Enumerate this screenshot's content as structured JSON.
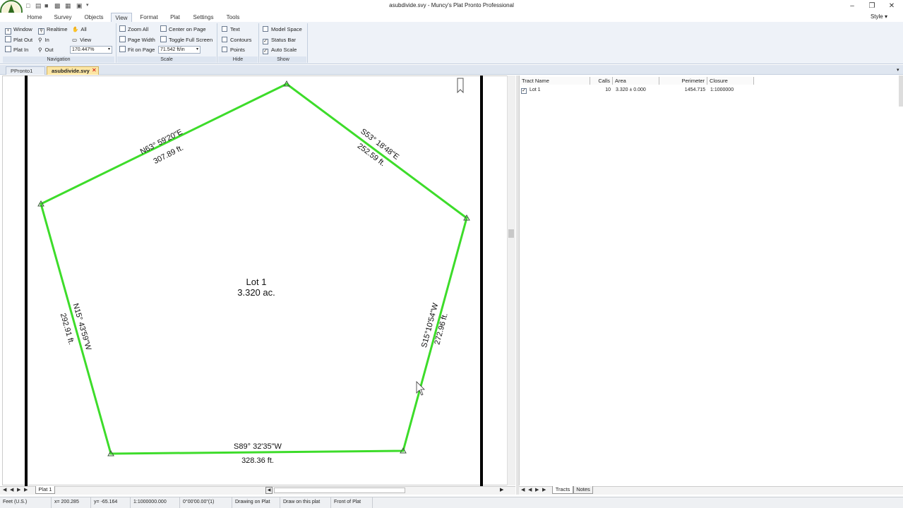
{
  "window": {
    "title": "asubdivide.svy - Muncy's Plat Pronto Professional",
    "minimize": "–",
    "restore": "❐",
    "close": "✕",
    "style_menu": "Style ▾"
  },
  "menu": {
    "tabs": [
      "Home",
      "Survey",
      "Objects",
      "View",
      "Format",
      "Plat",
      "Settings",
      "Tools"
    ],
    "active": "View"
  },
  "ribbon": {
    "navigation": {
      "label": "Navigation",
      "window": "Window",
      "realtime": "Realtime",
      "all": "All",
      "plat_out": "Plat Out",
      "in": "In",
      "view": "View",
      "plat_in": "Plat In",
      "out": "Out",
      "zoom_value": "170.447%"
    },
    "scale": {
      "label": "Scale",
      "zoom_all": "Zoom All",
      "center_on_page": "Center on Page",
      "page_width": "Page Width",
      "toggle_full_screen": "Toggle Full Screen",
      "fit_on_page": "Fit on Page",
      "scale_value": "71.542 ft/in"
    },
    "hide": {
      "label": "Hide",
      "text": "Text",
      "contours": "Contours",
      "points": "Points",
      "text_checked": false,
      "contours_checked": false,
      "points_checked": false
    },
    "show": {
      "label": "Show",
      "model_space": "Model Space",
      "status_bar": "Status Bar",
      "auto_scale": "Auto Scale",
      "model_space_checked": false,
      "status_bar_checked": true,
      "auto_scale_checked": true
    }
  },
  "doc_tabs": [
    {
      "label": "PPronto1",
      "active": false
    },
    {
      "label": "asubdivide.svy",
      "active": true
    }
  ],
  "plat": {
    "lot_name": "Lot 1",
    "lot_area": "3.320 ac.",
    "line_color": "#3ddc2a",
    "calls": [
      {
        "bearing": "N63° 59'20\"E",
        "distance": "307.89 ft."
      },
      {
        "bearing": "S53° 18'48\"E",
        "distance": "252.59 ft."
      },
      {
        "bearing": "S15°10'54\"W",
        "distance": "272.96 ft."
      },
      {
        "bearing": "S89° 32'35\"W",
        "distance": "328.36 ft."
      },
      {
        "bearing": "N15° 43'59\"W",
        "distance": "292.91 ft."
      }
    ],
    "sheet_tab": "Plat 1"
  },
  "tracts_table": {
    "columns": [
      "Tract Name",
      "Calls",
      "Area",
      "Perimeter",
      "Closure"
    ],
    "rows": [
      {
        "checked": true,
        "name": "Lot 1",
        "calls": "10",
        "area": "3.320 ± 0.000",
        "perimeter": "1454.715",
        "closure": "1:1000000"
      }
    ],
    "bottom_tabs": [
      "Tracts",
      "Notes"
    ]
  },
  "status_bar": {
    "units": "Feet (U.S.)",
    "x": "x= 200.285",
    "y": "y= -65.164",
    "closure": "1:1000000.000",
    "angle": "0°00'00.00\"(1)",
    "mode": "Drawing on Plat",
    "draw_target": "Draw on this plat",
    "side": "Front of Plat"
  }
}
